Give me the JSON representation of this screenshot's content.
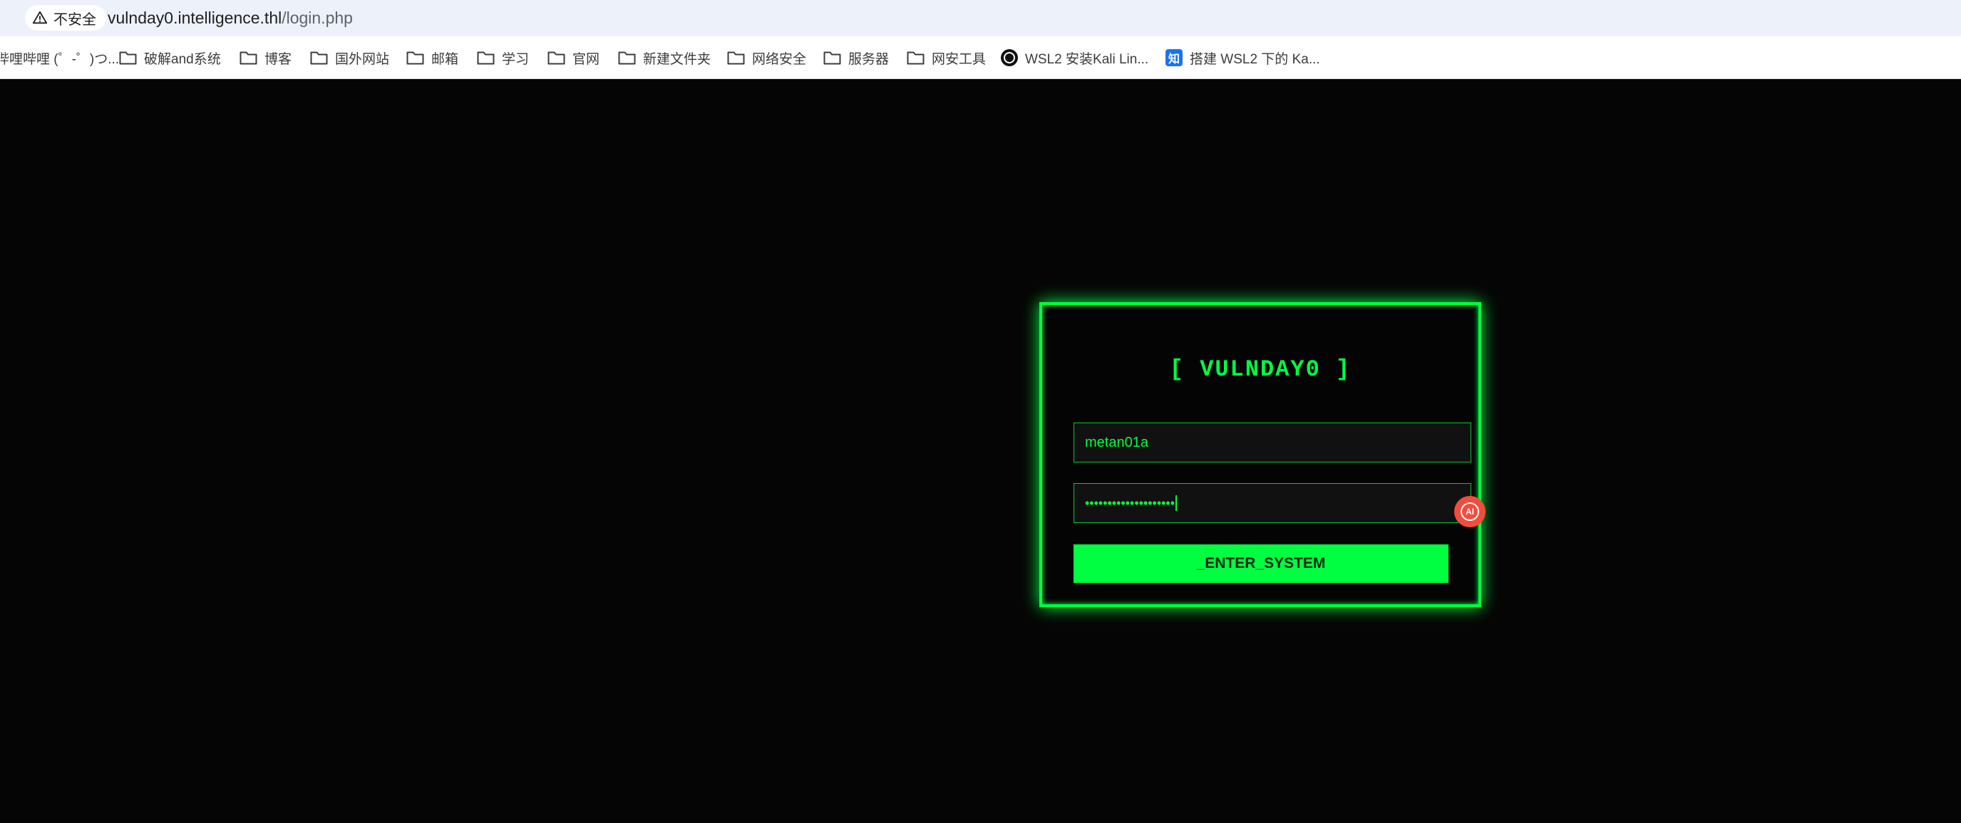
{
  "browser": {
    "security_label": "不安全",
    "url_host": "vulnday0.intelligence.thl",
    "url_path": "/login.php"
  },
  "bookmarks": [
    {
      "label": "哔哩哔哩 (゜-゜)つ...",
      "icon": "none"
    },
    {
      "label": "破解and系统",
      "icon": "folder-icon"
    },
    {
      "label": "博客",
      "icon": "folder-icon"
    },
    {
      "label": "国外网站",
      "icon": "folder-icon"
    },
    {
      "label": "邮箱",
      "icon": "folder-icon"
    },
    {
      "label": "学习",
      "icon": "folder-icon"
    },
    {
      "label": "官网",
      "icon": "folder-icon"
    },
    {
      "label": "新建文件夹",
      "icon": "folder-icon"
    },
    {
      "label": "网络安全",
      "icon": "folder-icon"
    },
    {
      "label": "服务器",
      "icon": "folder-icon"
    },
    {
      "label": "网安工具",
      "icon": "folder-icon"
    },
    {
      "label": "WSL2 安装Kali Lin...",
      "icon": "circle-icon"
    },
    {
      "label": "搭建 WSL2 下的 Ka...",
      "icon": "zhihu-icon"
    }
  ],
  "login": {
    "title": "[ VULNDAY0 ]",
    "username_value": "metan01a",
    "password_mask": "••••••••••••••••••••",
    "submit_label": "_ENTER_SYSTEM"
  },
  "ai_badge": {
    "label": "AI"
  },
  "colors": {
    "accent": "#00ff41",
    "background": "#050505",
    "badge": "#f24c3d"
  }
}
